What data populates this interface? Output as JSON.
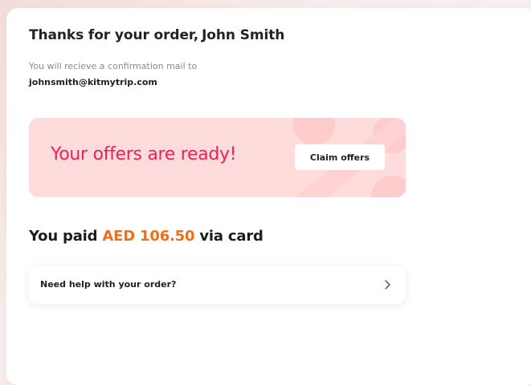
{
  "order": {
    "title_prefix": "Thanks for your order,",
    "customer_name": "John Smith",
    "confirmation_text": "You will recieve a confirmation mail to",
    "email": "johnsmith@kitmytrip.com"
  },
  "offers": {
    "title": "Your offers are ready!",
    "claim_label": "Claim offers",
    "banner_color": "#ffdcdc",
    "title_color": "#ee1f5a"
  },
  "payment": {
    "prefix": "You paid",
    "amount": "AED 106.50",
    "suffix": "via card",
    "amount_color": "#f36f15"
  },
  "help": {
    "label": "Need help with your order?",
    "icon": "chevron-right-icon"
  }
}
